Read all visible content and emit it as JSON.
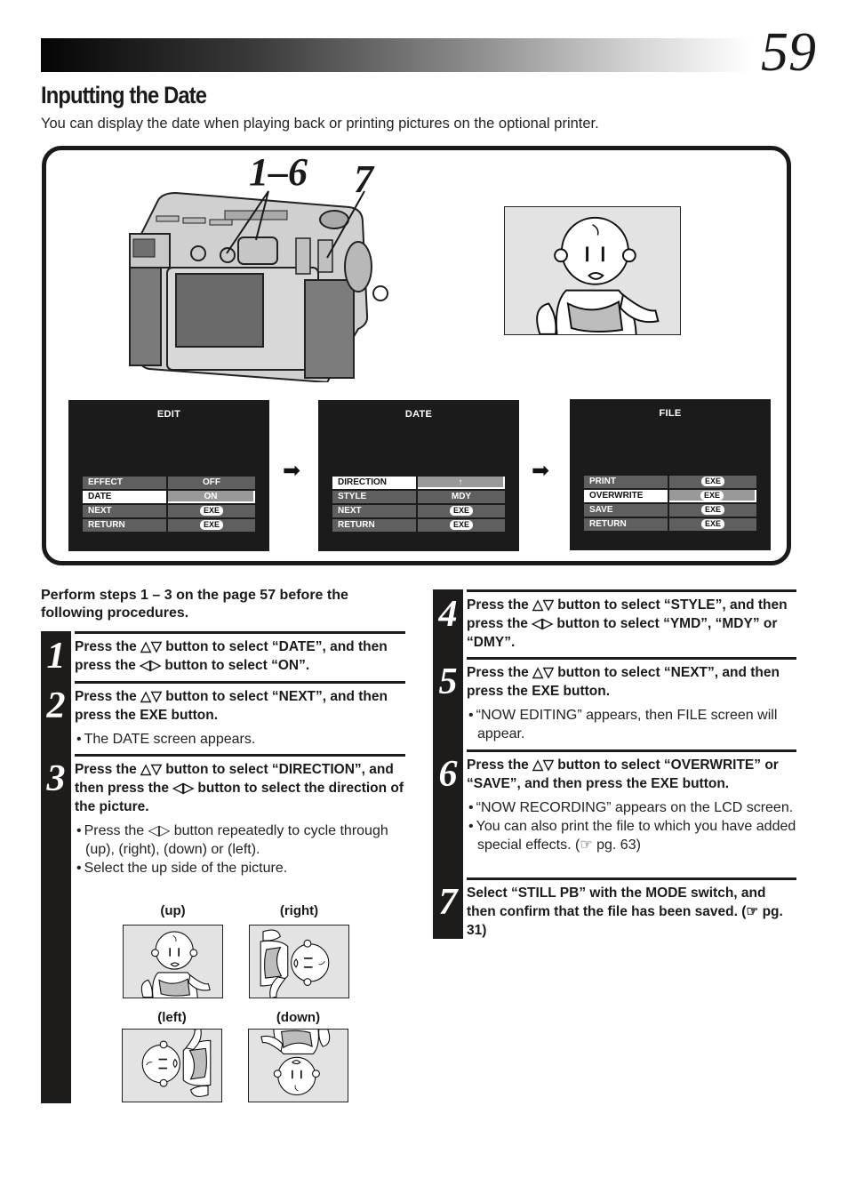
{
  "page": {
    "number": "59",
    "title": "Inputting the Date",
    "intro": "You can display the date when playing back or printing pictures on the optional printer."
  },
  "illustration": {
    "camera_callouts": [
      "1–6",
      "7"
    ],
    "camera_icon": "digital-camera",
    "preview_icon": "baby-picture-up",
    "screens": [
      {
        "title": "EDIT",
        "rows": [
          {
            "label": "EFFECT",
            "value": "OFF",
            "value_type": "text",
            "selected": false
          },
          {
            "label": "DATE",
            "value": "ON",
            "value_type": "text",
            "selected": true
          },
          {
            "label": "NEXT",
            "value": "EXE",
            "value_type": "pill",
            "selected": false
          },
          {
            "label": "RETURN",
            "value": "EXE",
            "value_type": "pill",
            "selected": false
          }
        ]
      },
      {
        "title": "DATE",
        "rows": [
          {
            "label": "DIRECTION",
            "value": "↑",
            "value_type": "text",
            "selected": true
          },
          {
            "label": "STYLE",
            "value": "MDY",
            "value_type": "text",
            "selected": false
          },
          {
            "label": "NEXT",
            "value": "EXE",
            "value_type": "pill",
            "selected": false
          },
          {
            "label": "RETURN",
            "value": "EXE",
            "value_type": "pill",
            "selected": false
          }
        ]
      },
      {
        "title": "FILE",
        "rows": [
          {
            "label": "PRINT",
            "value": "EXE",
            "value_type": "pill",
            "selected": false
          },
          {
            "label": "OVERWRITE",
            "value": "EXE",
            "value_type": "pill",
            "selected": true
          },
          {
            "label": "SAVE",
            "value": "EXE",
            "value_type": "pill",
            "selected": false
          },
          {
            "label": "RETURN",
            "value": "EXE",
            "value_type": "pill",
            "selected": false
          }
        ]
      }
    ],
    "flow_arrow_glyph": "➡"
  },
  "pre_note": "Perform steps 1 – 3 on the page 57 before the following procedures.",
  "steps": [
    {
      "num": "1",
      "head": "Press the △▽ button to select “DATE”, and then press the ◁▷ button to select “ON”.",
      "bullets": []
    },
    {
      "num": "2",
      "head": "Press the △▽ button to select “NEXT”, and then press the EXE button.",
      "bullets": [
        "The DATE screen appears."
      ]
    },
    {
      "num": "3",
      "head": "Press the △▽ button to select “DIRECTION”, and then press the ◁▷ button to select the direction of the picture.",
      "bullets": [
        "Press the ◁▷ button repeatedly to cycle through    (up),     (right),    (down) or     (left).",
        "Select the up side of the picture."
      ]
    },
    {
      "num": "4",
      "head": "Press the △▽ button to select “STYLE”, and then press the ◁▷ button to select “YMD”, “MDY” or “DMY”.",
      "bullets": []
    },
    {
      "num": "5",
      "head": "Press the △▽ button to select “NEXT”, and then press the EXE button.",
      "bullets": [
        "“NOW EDITING” appears, then FILE screen will appear."
      ]
    },
    {
      "num": "6",
      "head": "Press the △▽ button to select “OVERWRITE” or “SAVE”, and then press the EXE button.",
      "bullets": [
        "“NOW RECORDING” appears on the LCD screen.",
        "You can also print the file to which you have added special effects. (☞ pg. 63)"
      ]
    },
    {
      "num": "7",
      "head": "Select “STILL PB” with the MODE switch, and then confirm that the file has been saved. (☞ pg. 31)",
      "bullets": []
    }
  ],
  "directions": [
    {
      "label": "(up)",
      "rotation": 0
    },
    {
      "label": "(right)",
      "rotation": 90
    },
    {
      "label": "(left)",
      "rotation": 270
    },
    {
      "label": "(down)",
      "rotation": 180
    }
  ]
}
